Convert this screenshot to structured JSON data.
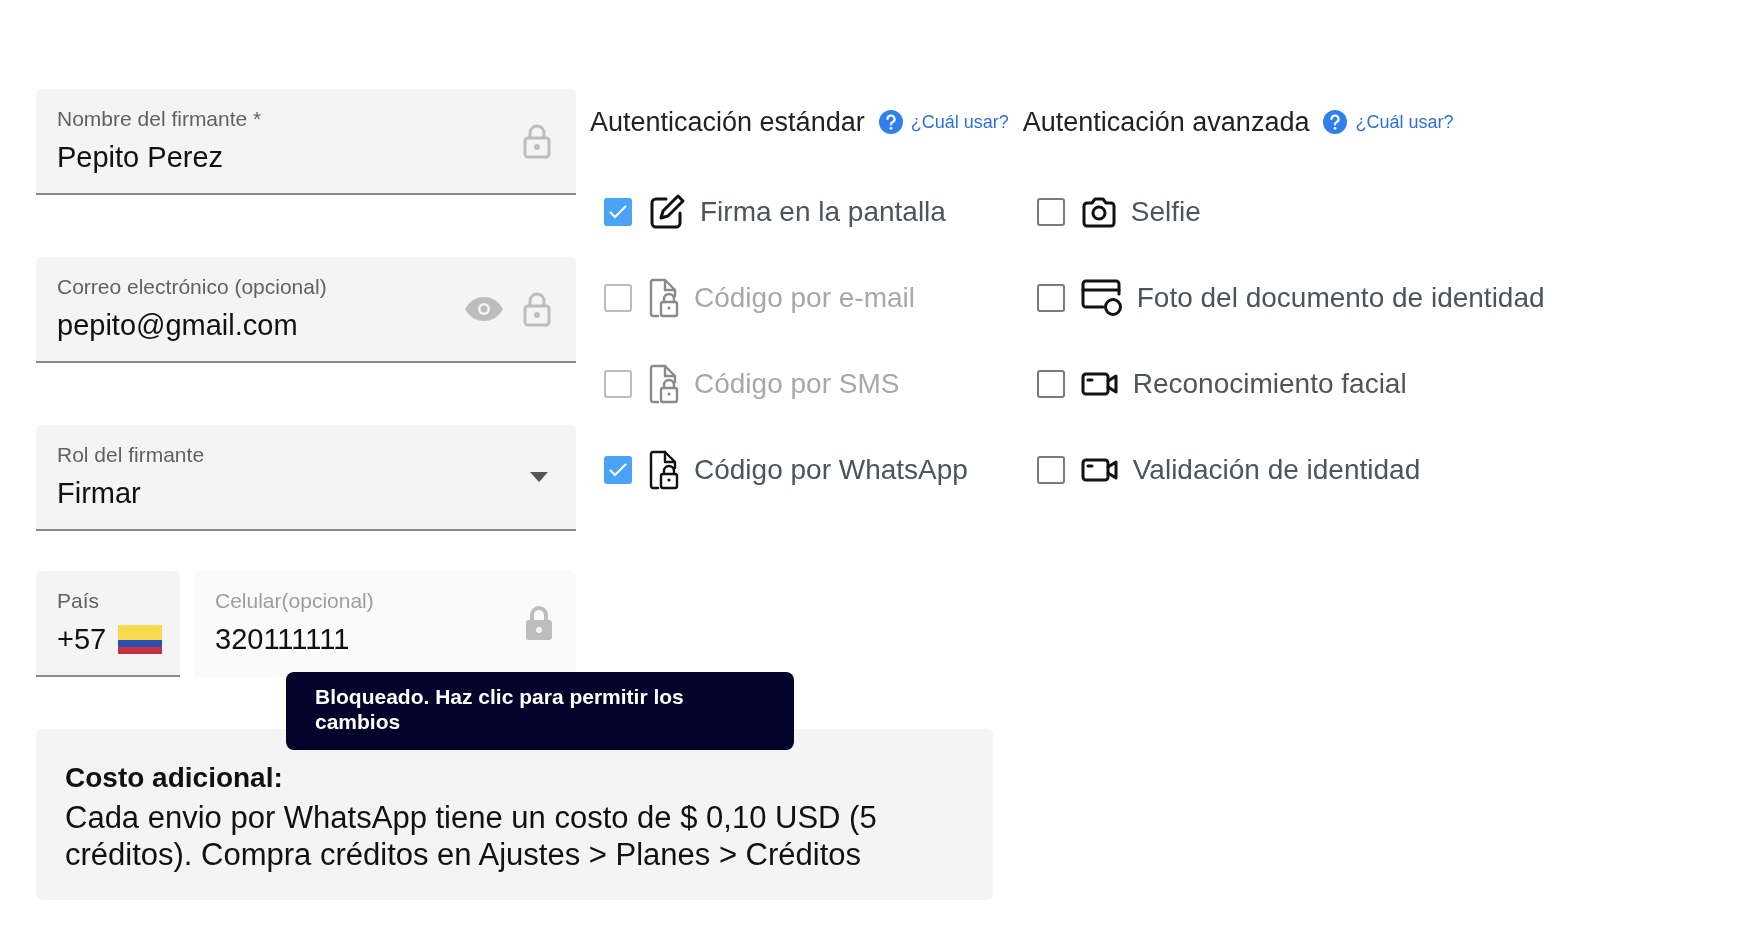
{
  "fields": [
    {
      "kind": "text",
      "label": "Nombre del firmante *",
      "value": "Pepito Perez",
      "disabled": false
    },
    {
      "kind": "email",
      "label": "Correo electrónico (opcional)",
      "value": "pepito@gmail.com",
      "disabled": false
    },
    {
      "kind": "select",
      "label": "Rol del firmante",
      "value": "Firmar",
      "disabled": false
    }
  ],
  "country": {
    "label": "País",
    "value": "+57"
  },
  "phone": {
    "label": "Celular(opcional)",
    "value": "320111111",
    "disabled": true
  },
  "tooltip": "Bloqueado. Haz clic para permitir los cambios",
  "auth_groups": [
    {
      "title": "Autenticación estándar",
      "help": "¿Cuál usar?",
      "options": [
        {
          "kind": "edit",
          "label": "Firma en la pantalla",
          "checked": true,
          "disabled": false
        },
        {
          "kind": "file-lock",
          "label": "Código por e-mail",
          "checked": false,
          "disabled": true
        },
        {
          "kind": "file-lock",
          "label": "Código por SMS",
          "checked": false,
          "disabled": true
        },
        {
          "kind": "file-lock",
          "label": "Código por WhatsApp",
          "checked": true,
          "disabled": false
        }
      ]
    },
    {
      "title": "Autenticación avanzada",
      "help": "¿Cuál usar?",
      "options": [
        {
          "kind": "camera",
          "label": "Selfie",
          "checked": false,
          "disabled": false
        },
        {
          "kind": "card",
          "label": "Foto del documento de identidad",
          "checked": false,
          "disabled": false
        },
        {
          "kind": "video",
          "label": "Reconocimiento facial",
          "checked": false,
          "disabled": false
        },
        {
          "kind": "video",
          "label": "Validación de identidad",
          "checked": false,
          "disabled": false
        }
      ]
    }
  ],
  "cost": {
    "title": "Costo adicional:",
    "text": "Cada envio por WhatsApp tiene un costo de $ 0,10 USD (5 créditos). Compra créditos en Ajustes > Planes > Créditos"
  }
}
